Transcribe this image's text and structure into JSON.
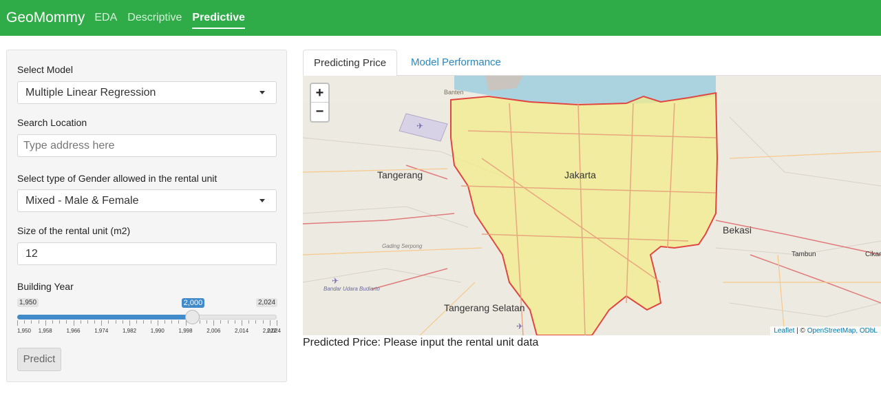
{
  "navbar": {
    "brand": "GeoMommy",
    "items": [
      {
        "label": "EDA",
        "active": false
      },
      {
        "label": "Descriptive",
        "active": false
      },
      {
        "label": "Predictive",
        "active": true
      }
    ]
  },
  "sidebar": {
    "model_label": "Select Model",
    "model_value": "Multiple Linear Regression",
    "location_label": "Search Location",
    "location_placeholder": "Type address here",
    "gender_label": "Select type of Gender allowed in the rental unit",
    "gender_value": "Mixed - Male & Female",
    "size_label": "Size of the rental unit (m2)",
    "size_value": "12",
    "year_label": "Building Year",
    "year_slider": {
      "min_label": "1,950",
      "max_label": "2,024",
      "value_label": "2,000",
      "min": 1950,
      "max": 2024,
      "value": 2000,
      "grid_labels": [
        "1,950",
        "1,958",
        "1,966",
        "1,974",
        "1,982",
        "1,990",
        "1,998",
        "2,006",
        "2,014",
        "2,022",
        "2,024"
      ]
    },
    "predict_button": "Predict"
  },
  "tabs": [
    {
      "label": "Predicting Price",
      "active": true
    },
    {
      "label": "Model Performance",
      "active": false
    }
  ],
  "map": {
    "zoom_in": "+",
    "zoom_out": "−",
    "place_labels": [
      "Banten",
      "Tangerang",
      "Jakarta",
      "Bekasi",
      "Gading Serpong",
      "Tangerang Selatan",
      "Bandar Udara Budiarto",
      "Tambun",
      "Cikarang"
    ],
    "attribution_link1": "Leaflet",
    "attribution_sep": " | © ",
    "attribution_link2": "OpenStreetMap, ODbL",
    "colors": {
      "region_fill": "#f2ec8a",
      "region_border": "#e0453f",
      "water": "#aad3df",
      "roads": "#e8a07a"
    }
  },
  "result_text": "Predicted Price: Please input the rental unit data"
}
